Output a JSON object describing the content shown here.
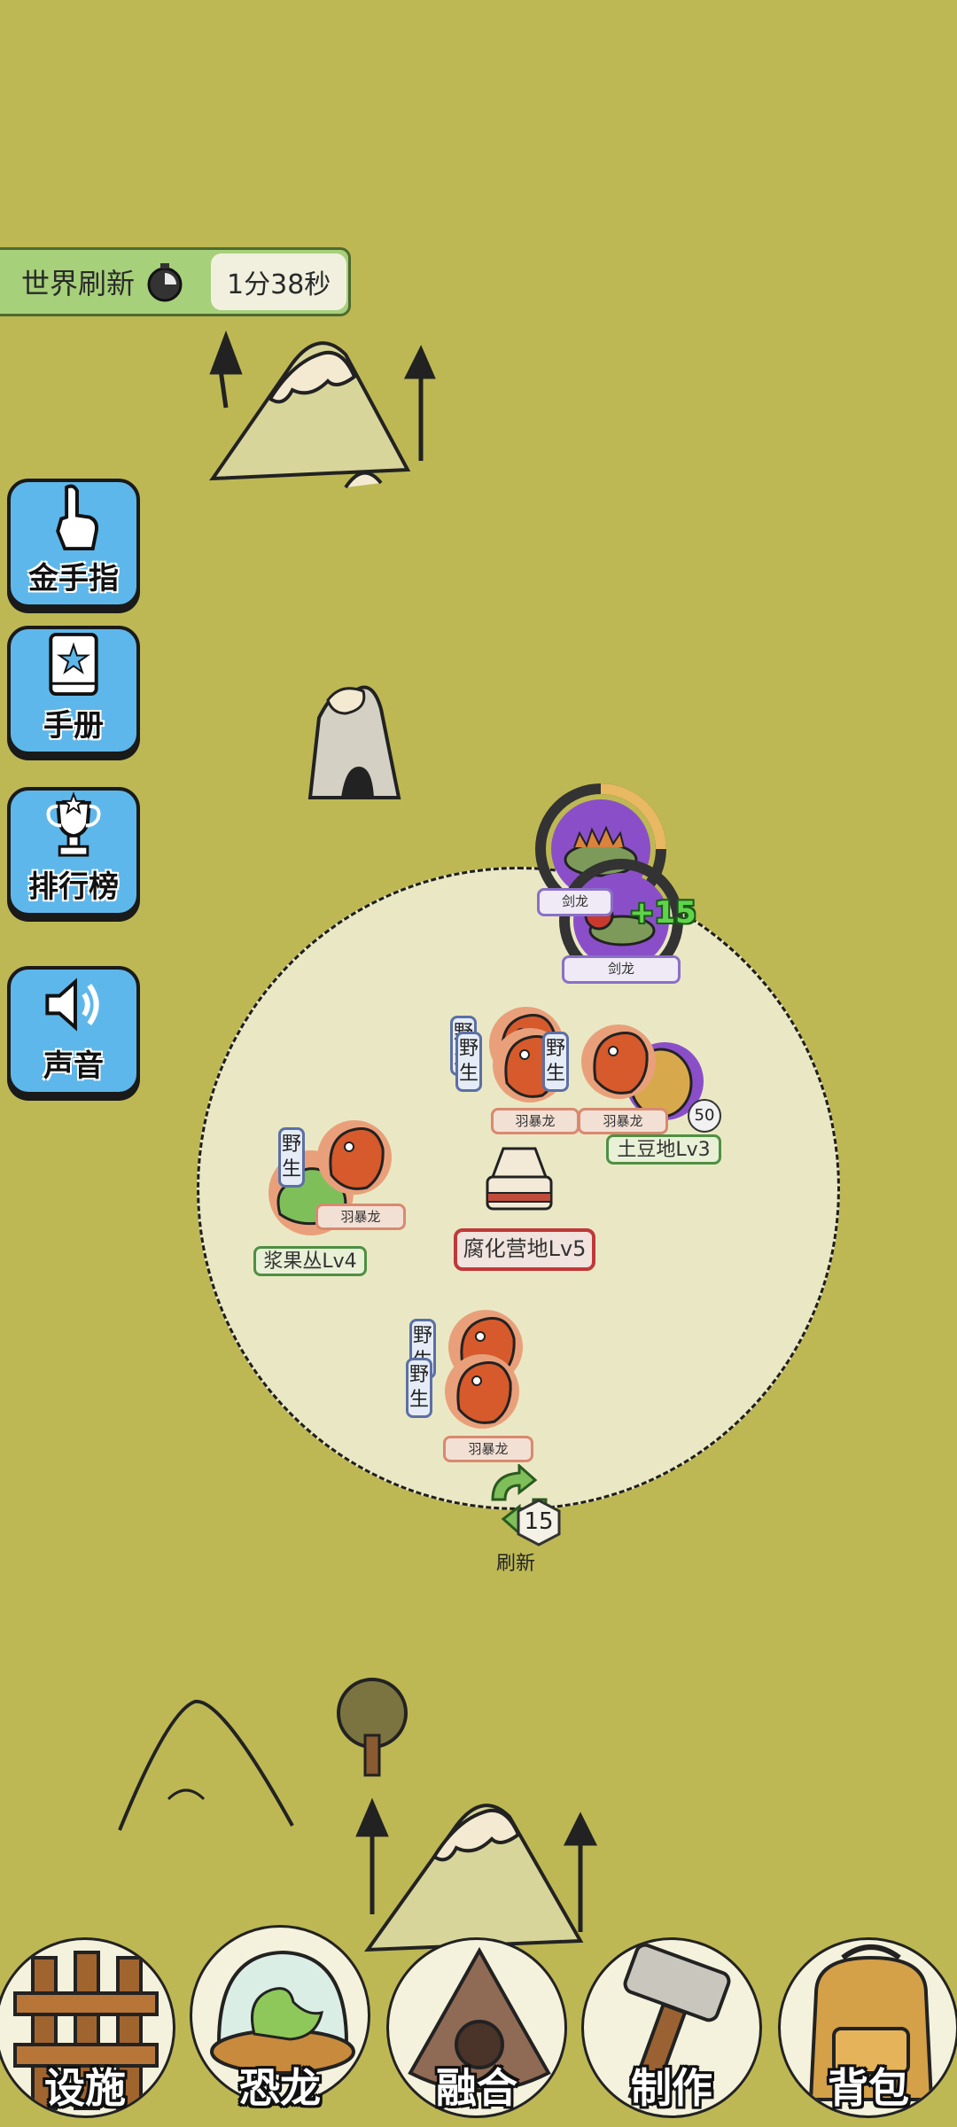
{
  "world_refresh": {
    "label": "世界刷新",
    "time": "1分38秒",
    "icon": "stopwatch-icon"
  },
  "side_menu": [
    {
      "label": "金手指",
      "icon": "finger-pointer-icon"
    },
    {
      "label": "手册",
      "icon": "book-star-icon"
    },
    {
      "label": "排行榜",
      "icon": "trophy-icon"
    },
    {
      "label": "声音",
      "icon": "speaker-icon"
    }
  ],
  "territory": {
    "camp": {
      "label": "腐化营地Lv5"
    },
    "potato_field": {
      "label": "土豆地Lv3",
      "count": "50"
    },
    "berry_bush": {
      "label": "浆果丛Lv4"
    },
    "wild_tag": {
      "char1": "野",
      "char2": "生"
    },
    "raptor_name": "羽暴龙",
    "stegosaurus": {
      "name1": "剑龙",
      "name2": "剑龙",
      "bonus": "+15"
    },
    "refresh": {
      "label": "刷新",
      "cost": "15"
    }
  },
  "bottom_nav": [
    {
      "label": "设施",
      "icon": "fence-icon"
    },
    {
      "label": "恐龙",
      "icon": "dino-dome-icon"
    },
    {
      "label": "融合",
      "icon": "fusion-icon"
    },
    {
      "label": "制作",
      "icon": "hammer-icon"
    },
    {
      "label": "背包",
      "icon": "backpack-icon"
    }
  ],
  "colors": {
    "ground": "#bdb854",
    "territory": "#eae8c4",
    "side_button": "#5eb7ea",
    "wild_border": "#5c6fa5",
    "raptor_border": "#d98970",
    "stego_border": "#8b6fc8",
    "field_border": "#4f8f42",
    "camp_border": "#c0393a"
  }
}
